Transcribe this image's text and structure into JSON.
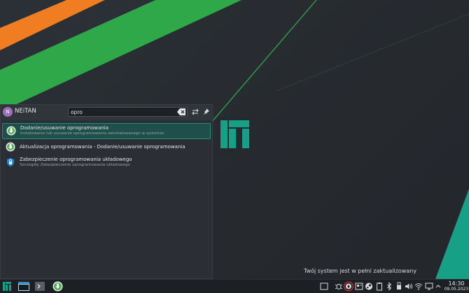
{
  "launcher": {
    "user": {
      "initial": "N",
      "name": "NEiTAN"
    },
    "search": {
      "value": "opro"
    },
    "results": [
      {
        "title": "Dodanie/usuwanie oprogramowania",
        "subtitle": "Instalowanie lub usuwanie oprogramowania zainstalowanego w systemie",
        "icon": "software-add-remove-icon",
        "selected": true
      },
      {
        "title": "Aktualizacja oprogramowania - Dodanie/usuwanie oprogramowania",
        "subtitle": "",
        "icon": "software-update-icon",
        "selected": false
      },
      {
        "title": "Zabezpieczenie oprogramowania układowego",
        "subtitle": "Szczegóły Zabezpieczenie oprogramowania układowego",
        "icon": "firmware-security-icon",
        "selected": false
      }
    ]
  },
  "notification": {
    "text": "Twój system jest w pełni zaktualizowany"
  },
  "taskbar": {
    "clock": {
      "time": "14:30",
      "date": "09.05.2023"
    }
  },
  "colors": {
    "accent": "#16a085",
    "green": "#2fa84a",
    "orange": "#f07d22",
    "highlight_ring": "#e0303a"
  }
}
